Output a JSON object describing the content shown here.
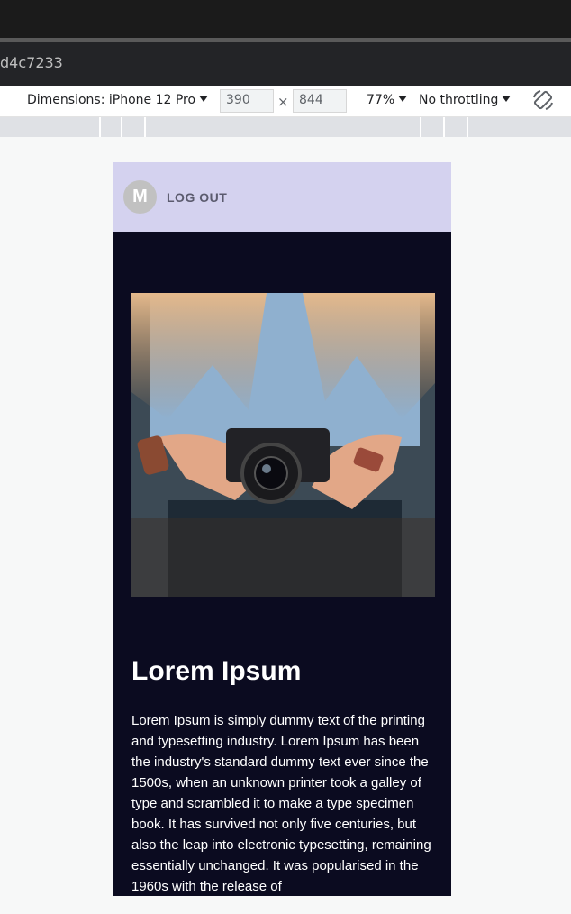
{
  "browser": {
    "url_fragment": "d4c7233"
  },
  "devtools": {
    "dimensions_label": "Dimensions: iPhone 12 Pro",
    "width_value": "390",
    "times_symbol": "×",
    "height_value": "844",
    "zoom": "77%",
    "throttling": "No throttling"
  },
  "app": {
    "avatar_letter": "M",
    "logout_label": "LOG OUT",
    "title": "Lorem Ipsum",
    "body": "Lorem Ipsum is simply dummy text of the printing and typesetting industry. Lorem Ipsum has been the industry's standard dummy text ever since the 1500s, when an unknown printer took a galley of type and scrambled it to make a type specimen book. It has survived not only five centuries, but also the leap into electronic typesetting, remaining essentially unchanged. It was popularised in the 1960s with the release of"
  },
  "colors": {
    "header_bg": "#d4d2ef",
    "page_bg": "#0b0b20"
  }
}
